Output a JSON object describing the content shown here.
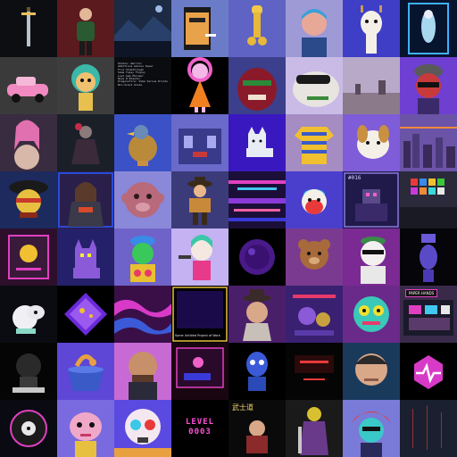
{
  "tiles": [
    {
      "name": "sword",
      "bg": "#0d0e12"
    },
    {
      "name": "woman-plants",
      "bg": "#5a1a1e"
    },
    {
      "name": "night-landscape",
      "bg": "#1c2a44"
    },
    {
      "name": "pixel-smoker",
      "bg": "#6a7cc8"
    },
    {
      "name": "golden-figure",
      "bg": "#5f63c4"
    },
    {
      "name": "nft-girl",
      "bg": "#9e9ad6"
    },
    {
      "name": "giraffe-toon",
      "bg": "#3e3ec6"
    },
    {
      "name": "tarot-card",
      "bg": "#07142e"
    },
    {
      "name": "car-toon",
      "bg": "#3a3a3a"
    },
    {
      "name": "dread-boy",
      "bg": "#3d3d3d"
    },
    {
      "name": "text-list",
      "bg": "#0b0c10"
    },
    {
      "name": "devil-girl",
      "bg": "#000000"
    },
    {
      "name": "red-monster",
      "bg": "#3b3f8c"
    },
    {
      "name": "frog-goggles",
      "bg": "#c9bbe6"
    },
    {
      "name": "desert-stones",
      "bg": "#b9a9c9"
    },
    {
      "name": "purple-cap-man",
      "bg": "#6f3fd2"
    },
    {
      "name": "fantasy-woman",
      "bg": "#3a2c40"
    },
    {
      "name": "dark-figure",
      "bg": "#1b2028"
    },
    {
      "name": "pigeon",
      "bg": "#3b52c6"
    },
    {
      "name": "rooftop-scene",
      "bg": "#6a6aca"
    },
    {
      "name": "pixel-cat",
      "bg": "#3a18c0"
    },
    {
      "name": "striped-shirt",
      "bg": "#a58cc2"
    },
    {
      "name": "cat-dog",
      "bg": "#7f5cd8"
    },
    {
      "name": "city-glitch",
      "bg": "#6b53a7"
    },
    {
      "name": "bandit-skull",
      "bg": "#1d2a5e"
    },
    {
      "name": "hooded-warrior",
      "bg": "#2a1f4a"
    },
    {
      "name": "clay-monkey",
      "bg": "#8a88d8"
    },
    {
      "name": "cowboy-figure",
      "bg": "#3b3b7a"
    },
    {
      "name": "glitch-screen",
      "bg": "#1b0f3a"
    },
    {
      "name": "cartoon-fox",
      "bg": "#4a3fcc"
    },
    {
      "name": "robot-016",
      "bg": "#1f1a4a",
      "label": "#016"
    },
    {
      "name": "art-gallery",
      "bg": "#2a2a3a"
    },
    {
      "name": "neon-frame",
      "bg": "#2d0f2c"
    },
    {
      "name": "pixel-cat-neon",
      "bg": "#24206a"
    },
    {
      "name": "pop-character",
      "bg": "#6f62c8"
    },
    {
      "name": "anime-cat-girl",
      "bg": "#c4b2f2"
    },
    {
      "name": "purple-orb",
      "bg": "#000000"
    },
    {
      "name": "brown-bear",
      "bg": "#7a3a90"
    },
    {
      "name": "polar-bear",
      "bg": "#7a2a92"
    },
    {
      "name": "purple-robot",
      "bg": "#05050a"
    },
    {
      "name": "white-creature",
      "bg": "#0b0b12"
    },
    {
      "name": "glowing-diamond",
      "bg": "#000000"
    },
    {
      "name": "abstract-waves",
      "bg": "#3a0f48"
    },
    {
      "name": "dark-panel",
      "bg": "#000000",
      "caption": "Some Untitled Project of Work"
    },
    {
      "name": "hat-creature",
      "bg": "#4a1f6a"
    },
    {
      "name": "purple-chaos",
      "bg": "#3a2070"
    },
    {
      "name": "teal-monster",
      "bg": "#6a2a8a"
    },
    {
      "name": "paper-hands",
      "bg": "#3a2a4a",
      "banner": "PAPER HANDS"
    },
    {
      "name": "black-shape",
      "bg": "#050505"
    },
    {
      "name": "teacup-snake",
      "bg": "#5e46d6"
    },
    {
      "name": "bald-man",
      "bg": "#c86ad4"
    },
    {
      "name": "neon-frame-2",
      "bg": "#1a0610"
    },
    {
      "name": "blue-robot",
      "bg": "#000000"
    },
    {
      "name": "red-neon-city",
      "bg": "#050505"
    },
    {
      "name": "tech-portrait",
      "bg": "#1a3a5c"
    },
    {
      "name": "logo-pulse",
      "bg": "#000000"
    },
    {
      "name": "vinyl-record",
      "bg": "#0a0a12"
    },
    {
      "name": "alien-toon",
      "bg": "#7a6ae0"
    },
    {
      "name": "skull-toy",
      "bg": "#5a4ae0"
    },
    {
      "name": "level-sign",
      "bg": "#000000",
      "text": "LEVEL\n0003"
    },
    {
      "name": "samurai-text",
      "bg": "#0a0a0a",
      "text": "武士道"
    },
    {
      "name": "samurai-warrior",
      "bg": "#1a1a1a"
    },
    {
      "name": "red-hair-robot",
      "bg": "#7a7ad8"
    },
    {
      "name": "dark-rain",
      "bg": "#1a2030"
    }
  ],
  "text_list": [
    "Status: Warrior",
    "Ambitious Genius Super",
    "Fire Stubthrough",
    "Some Topsy Flopsy",
    "Lost Gem Phinder",
    "Nova R Blaster",
    "Dragonsfire: Vobe Versus Droids",
    "Bio-Scent Glaze"
  ],
  "colors": {
    "accent": "#e040c0",
    "neon": "#ff4fd8",
    "gold": "#f5d36a"
  }
}
